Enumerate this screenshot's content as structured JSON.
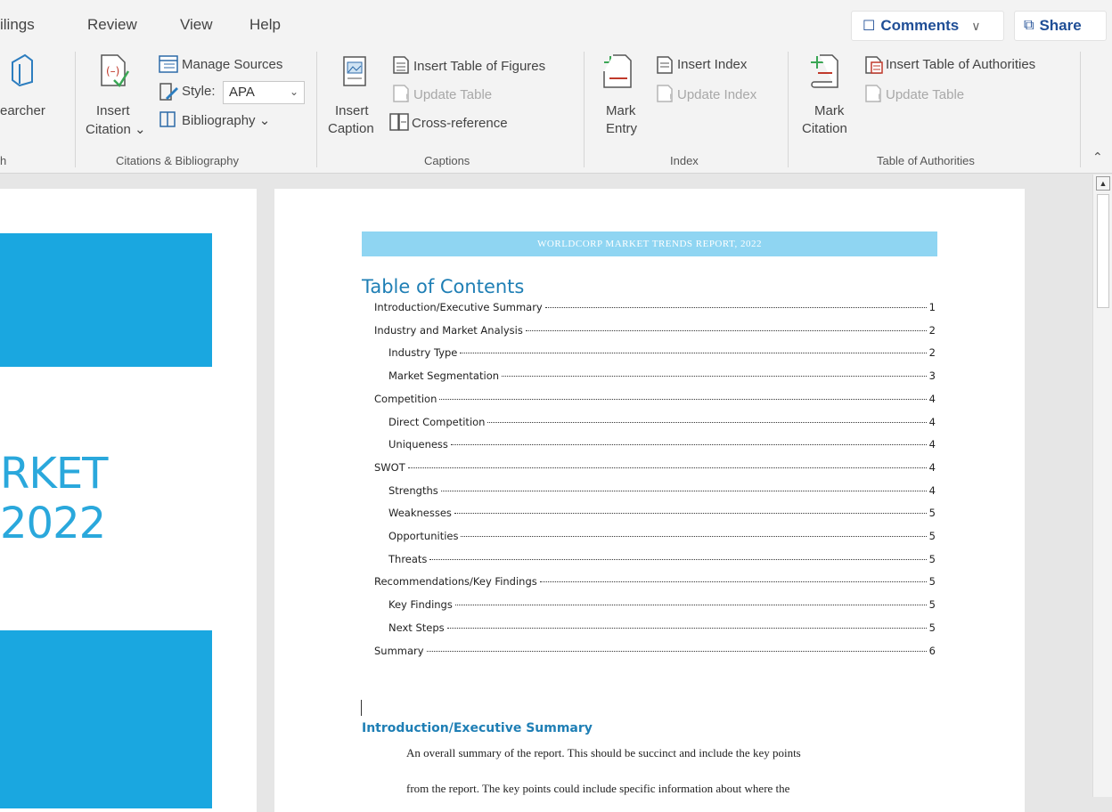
{
  "menubar": {
    "items": [
      "ilings",
      "Review",
      "View",
      "Help"
    ],
    "comments_label": "Comments",
    "share_label": "Share"
  },
  "ribbon": {
    "research": {
      "label": "earcher",
      "group": "h"
    },
    "citations": {
      "insert_citation": [
        "Insert",
        "Citation"
      ],
      "manage_sources": "Manage Sources",
      "style_label": "Style:",
      "style_value": "APA",
      "bibliography": "Bibliography",
      "group": "Citations & Bibliography"
    },
    "captions": {
      "insert_caption": [
        "Insert",
        "Caption"
      ],
      "insert_table_of_figures": "Insert Table of Figures",
      "update_table": "Update Table",
      "cross_reference": "Cross-reference",
      "group": "Captions"
    },
    "index": {
      "mark_entry": [
        "Mark",
        "Entry"
      ],
      "insert_index": "Insert Index",
      "update_index": "Update Index",
      "group": "Index"
    },
    "authorities": {
      "mark_citation": [
        "Mark",
        "Citation"
      ],
      "insert_table_of_authorities": "Insert Table of Authorities",
      "update_table": "Update Table",
      "group": "Table of Authorities"
    }
  },
  "prev_page": {
    "title_line1": "RKET",
    "title_line2": "2022"
  },
  "document": {
    "header": "WORLDCORP MARKET TRENDS REPORT, 2022",
    "toc_title": "Table of Contents",
    "toc": [
      {
        "label": "Introduction/Executive Summary",
        "page": "1",
        "level": 1
      },
      {
        "label": "Industry and Market Analysis",
        "page": "2",
        "level": 1
      },
      {
        "label": "Industry Type",
        "page": "2",
        "level": 2
      },
      {
        "label": "Market Segmentation",
        "page": "3",
        "level": 2
      },
      {
        "label": "Competition",
        "page": "4",
        "level": 1
      },
      {
        "label": "Direct Competition",
        "page": "4",
        "level": 2
      },
      {
        "label": "Uniqueness",
        "page": "4",
        "level": 2
      },
      {
        "label": "SWOT",
        "page": "4",
        "level": 1
      },
      {
        "label": "Strengths",
        "page": "4",
        "level": 2
      },
      {
        "label": "Weaknesses",
        "page": "5",
        "level": 2
      },
      {
        "label": "Opportunities",
        "page": "5",
        "level": 2
      },
      {
        "label": "Threats",
        "page": "5",
        "level": 2
      },
      {
        "label": "Recommendations/Key Findings",
        "page": "5",
        "level": 1
      },
      {
        "label": "Key Findings",
        "page": "5",
        "level": 2
      },
      {
        "label": "Next Steps",
        "page": "5",
        "level": 2
      },
      {
        "label": "Summary",
        "page": "6",
        "level": 1
      }
    ],
    "intro_heading": "Introduction/Executive Summary",
    "body_lines": [
      "An overall summary of the report.  This should be succinct and include the key points",
      "from the report.  The key points could include specific information about where the"
    ]
  },
  "colors": {
    "accent": "#1f4e96",
    "cyan": "#1aa7e0",
    "header_band": "#8fd5f2",
    "heading_blue": "#1f7fb5"
  }
}
